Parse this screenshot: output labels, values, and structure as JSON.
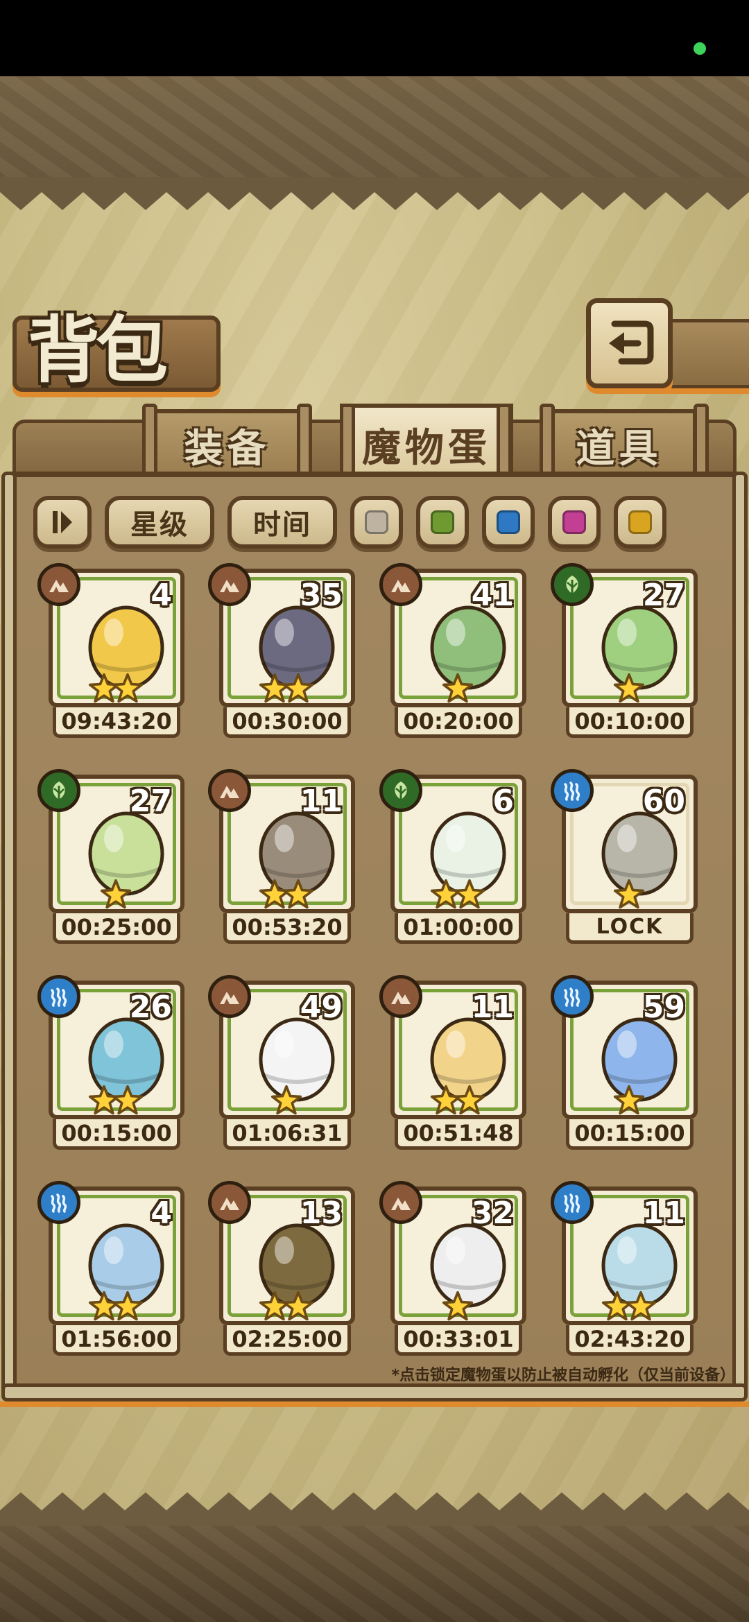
{
  "page": {
    "title": "背包"
  },
  "tabs": [
    {
      "label": "装备",
      "active": false
    },
    {
      "label": "魔物蛋",
      "active": true
    },
    {
      "label": "道具",
      "active": false
    }
  ],
  "filters": {
    "sort_icon": "sort-toggle-icon",
    "star_label": "星级",
    "time_label": "时间",
    "colors": [
      "#bdb3a0",
      "#6f9a31",
      "#2f78c4",
      "#c23f93",
      "#d9a521"
    ]
  },
  "eggs": [
    {
      "element": "earth",
      "count": "4",
      "stars": 2,
      "time": "09:43:20",
      "color": "#f2c84a"
    },
    {
      "element": "earth",
      "count": "35",
      "stars": 2,
      "time": "00:30:00",
      "color": "#6c6a80"
    },
    {
      "element": "earth",
      "count": "41",
      "stars": 1,
      "time": "00:20:00",
      "color": "#8fbf7a"
    },
    {
      "element": "grass",
      "count": "27",
      "stars": 1,
      "time": "00:10:00",
      "color": "#9fd07f"
    },
    {
      "element": "grass",
      "count": "27",
      "stars": 1,
      "time": "00:25:00",
      "color": "#c9e09a"
    },
    {
      "element": "earth",
      "count": "11",
      "stars": 2,
      "time": "00:53:20",
      "color": "#9a8c7a"
    },
    {
      "element": "grass",
      "count": "6",
      "stars": 2,
      "time": "01:00:00",
      "color": "#eaf2e6"
    },
    {
      "element": "water",
      "count": "60",
      "stars": 1,
      "time": "LOCK",
      "color": "#b8b6a8"
    },
    {
      "element": "water",
      "count": "26",
      "stars": 2,
      "time": "00:15:00",
      "color": "#7fc4d8"
    },
    {
      "element": "earth",
      "count": "49",
      "stars": 1,
      "time": "01:06:31",
      "color": "#f4f4f4"
    },
    {
      "element": "earth",
      "count": "11",
      "stars": 2,
      "time": "00:51:48",
      "color": "#f2d38a"
    },
    {
      "element": "water",
      "count": "59",
      "stars": 1,
      "time": "00:15:00",
      "color": "#8fb6ec"
    },
    {
      "element": "water",
      "count": "4",
      "stars": 2,
      "time": "01:56:00",
      "color": "#a9cde8"
    },
    {
      "element": "earth",
      "count": "13",
      "stars": 2,
      "time": "02:25:00",
      "color": "#7d6a3e"
    },
    {
      "element": "earth",
      "count": "32",
      "stars": 1,
      "time": "00:33:01",
      "color": "#eeeeee"
    },
    {
      "element": "water",
      "count": "11",
      "stars": 2,
      "time": "02:43:20",
      "color": "#b9dce8"
    }
  ],
  "footnote": "*点击锁定魔物蛋以防止被自动孵化（仅当前设备）"
}
